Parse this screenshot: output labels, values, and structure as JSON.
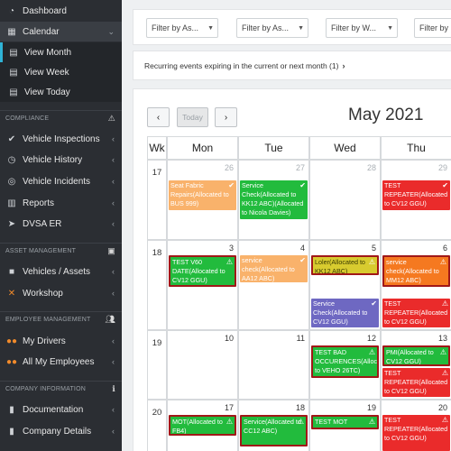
{
  "sidebar": {
    "dashboard": "Dashboard",
    "calendar": "Calendar",
    "view_month": "View Month",
    "view_week": "View Week",
    "view_today": "View Today",
    "compliance_title": "COMPLIANCE",
    "vehicle_inspections": "Vehicle Inspections",
    "vehicle_history": "Vehicle History",
    "vehicle_incidents": "Vehicle Incidents",
    "reports": "Reports",
    "dvsa_er": "DVSA ER",
    "asset_title": "ASSET MANAGEMENT",
    "vehicles_assets": "Vehicles / Assets",
    "workshop": "Workshop",
    "employee_title": "EMPLOYEE MANAGEMENT",
    "my_drivers": "My Drivers",
    "all_employees": "All My Employees",
    "company_title": "COMPANY INFORMATION",
    "documentation": "Documentation",
    "company_details": "Company Details"
  },
  "filters": [
    "Filter by As...",
    "Filter by As...",
    "Filter by W...",
    "Filter by"
  ],
  "notice": "Recurring events expiring in the current or next month (1)",
  "calendar": {
    "prev": "‹",
    "today": "Today",
    "next": "›",
    "title": "May 2021",
    "wk_header": "Wk",
    "day_headers": [
      "Mon",
      "Tue",
      "Wed",
      "Thu"
    ],
    "weeks": [
      {
        "wk": "17",
        "days": [
          "26",
          "27",
          "28",
          "29"
        ],
        "other": [
          true,
          true,
          true,
          true
        ]
      },
      {
        "wk": "18",
        "days": [
          "3",
          "4",
          "5",
          "6"
        ],
        "other": [
          false,
          false,
          false,
          false
        ]
      },
      {
        "wk": "19",
        "days": [
          "10",
          "11",
          "12",
          "13"
        ],
        "other": [
          false,
          false,
          false,
          false
        ]
      },
      {
        "wk": "20",
        "days": [
          "17",
          "18",
          "19",
          "20"
        ],
        "other": [
          false,
          false,
          false,
          false
        ]
      }
    ],
    "events": {
      "e1": "Seat Fabric Repairs(Allocated to BUS 999)",
      "e2": "Service Check(Allocated to KK12 ABC)(Allocated to Nicola Davies)",
      "e3": "TEST REPEATER(Allocated to CV12 GGU)",
      "e4": "TEST V60 DATE(Allocated to CV12 GGU)",
      "e5": "service check(Allocated to AA12 ABC)",
      "e6": "Loler(Allocated to KK12 ABC)",
      "e7": "service check(Allocated to MM12 ABC)",
      "e8": "Service Check(Allocated to CV12 GGU)",
      "e9": "TEST REPEATER(Allocated to CV12 GGU)",
      "e10": "TEST BAD OCCURENCES(Allocated to VEHO 26TC)",
      "e11": "PMI(Allocated to CV12 GGU)",
      "e12": "TEST REPEATER(Allocated to CV12 GGU)",
      "e13": "MOT(Allocated to FB4)",
      "e14": "Service(Allocated to CC12 ABC)",
      "e15": "TEST MOT",
      "e16": "TEST REPEATER(Allocated to CV12 GGU)"
    }
  }
}
